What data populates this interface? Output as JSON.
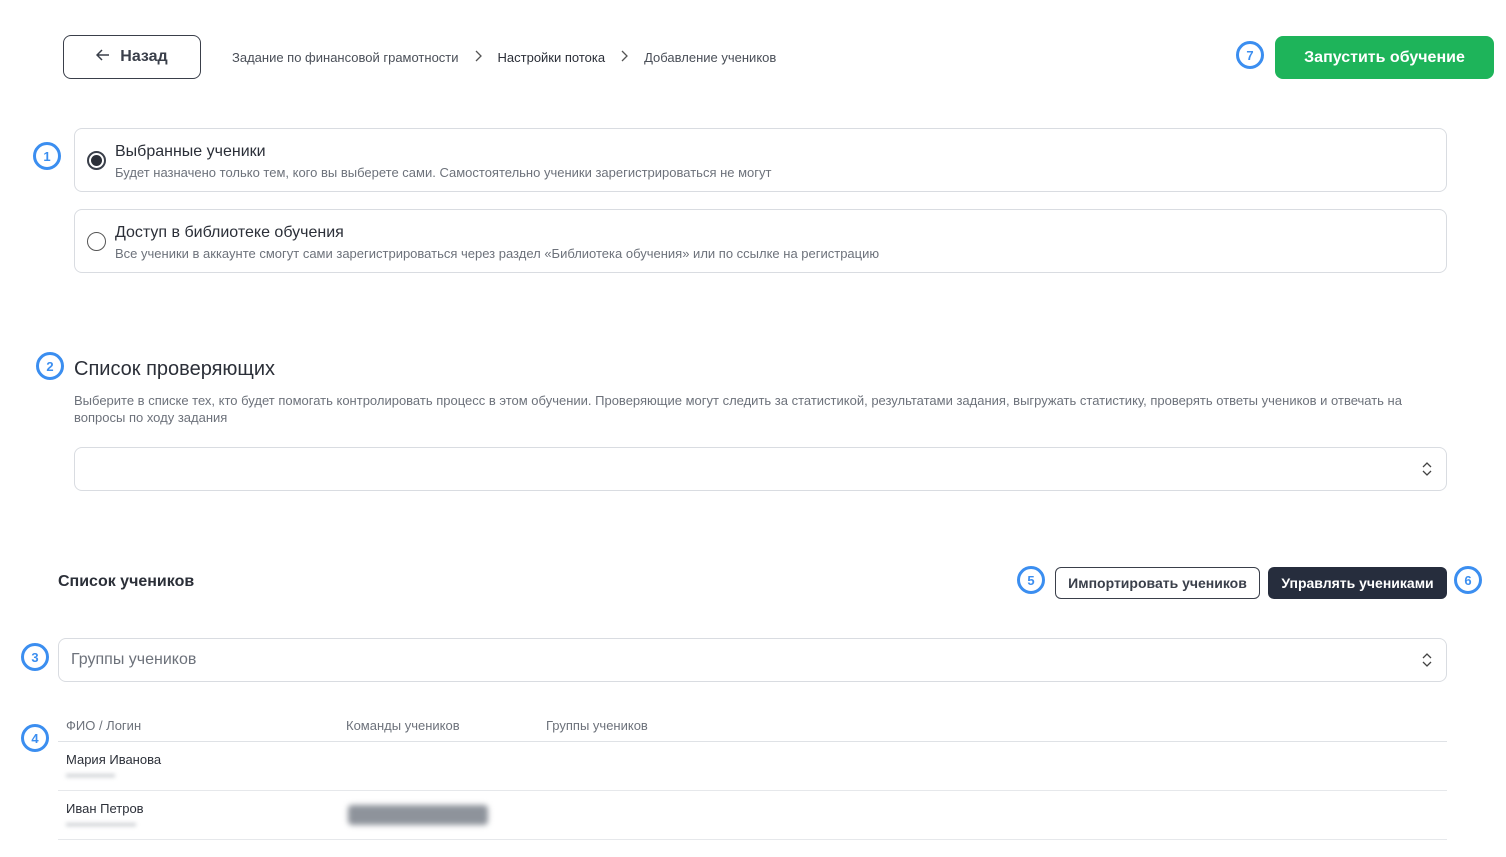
{
  "header": {
    "back_label": "Назад",
    "breadcrumb": [
      "Задание по финансовой грамотности",
      "Настройки потока",
      "Добавление учеников"
    ],
    "start_label": "Запустить обучение"
  },
  "access_options": [
    {
      "title": "Выбранные ученики",
      "description": "Будет назначено только тем, кого вы выберете сами. Самостоятельно ученики зарегистрироваться не могут",
      "selected": true
    },
    {
      "title": "Доступ в библиотеке обучения",
      "description": "Все ученики в аккаунте смогут сами зарегистрироваться через раздел «Библиотека обучения» или по ссылке на регистрацию",
      "selected": false
    }
  ],
  "reviewers": {
    "title": "Список проверяющих",
    "description": "Выберите в списке тех, кто будет помогать контролировать процесс в этом обучении. Проверяющие могут следить за статистикой, результатами задания, выгружать статистику, проверять ответы учеников и отвечать на вопросы по ходу задания",
    "value": ""
  },
  "students": {
    "title": "Список учеников",
    "import_label": "Импортировать учеников",
    "manage_label": "Управлять учениками",
    "groups_placeholder": "Группы учеников",
    "columns": [
      "ФИО / Логин",
      "Команды учеников",
      "Группы учеников"
    ],
    "rows": [
      {
        "name": "Мария Иванова",
        "login": "••••••••••••••",
        "team": "",
        "groups": ""
      },
      {
        "name": "Иван Петров",
        "login": "••••••••••••••••••••",
        "team": "•••••",
        "groups": ""
      }
    ]
  },
  "markers": [
    "1",
    "2",
    "3",
    "4",
    "5",
    "6",
    "7"
  ],
  "colors": {
    "accent_green": "#1eb45a",
    "dark_button": "#262d3d",
    "marker_blue": "#3b8ef0"
  }
}
